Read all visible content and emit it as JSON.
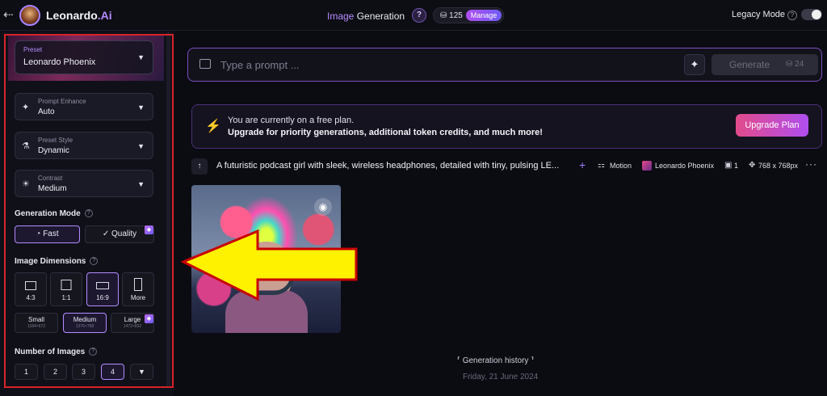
{
  "header": {
    "brand_name": "Leonardo",
    "brand_suffix": ".Ai",
    "mode_title_accent": "Image",
    "mode_title_rest": " Generation",
    "help_label": "?",
    "token_count": "125",
    "manage_label": "Manage",
    "legacy_mode_label": "Legacy Mode",
    "legacy_mode_on": false
  },
  "sidebar": {
    "preset": {
      "label": "Preset",
      "value": "Leonardo Phoenix"
    },
    "prompt_enhance": {
      "label": "Prompt Enhance",
      "value": "Auto"
    },
    "preset_style": {
      "label": "Preset Style",
      "value": "Dynamic"
    },
    "contrast": {
      "label": "Contrast",
      "value": "Medium"
    },
    "generation_mode": {
      "title": "Generation Mode",
      "fast_label": "Fast",
      "quality_label": "Quality",
      "selected": "Fast"
    },
    "image_dimensions": {
      "title": "Image Dimensions",
      "ratios": [
        "4:3",
        "1:1",
        "16:9",
        "More"
      ],
      "selected_ratio": "16:9",
      "sizes": [
        {
          "name": "Small",
          "px": "1184×672"
        },
        {
          "name": "Medium",
          "px": "1376×768"
        },
        {
          "name": "Large",
          "px": "1472×832"
        }
      ],
      "selected_size": "Medium"
    },
    "number_of_images": {
      "title": "Number of Images",
      "options": [
        "1",
        "2",
        "3",
        "4"
      ],
      "selected": "4"
    }
  },
  "prompt": {
    "placeholder": "Type a prompt ...",
    "value": "",
    "generate_label": "Generate",
    "generate_cost": "24"
  },
  "banner": {
    "line1": "You are currently on a free plan.",
    "line2": "Upgrade for priority generations, additional token credits, and much more!",
    "upgrade_label": "Upgrade Plan"
  },
  "generation": {
    "prompt_text": "A futuristic podcast girl with sleek, wireless headphones, detailed with tiny, pulsing LE...",
    "motion_label": "Motion",
    "model_label": "Leonardo Phoenix",
    "image_count": "1",
    "dimensions": "768 x 768px"
  },
  "history": {
    "title": "Generation history",
    "date": "Friday, 21 June 2024"
  },
  "colors": {
    "accent": "#b48cff",
    "highlight_outline": "#d8232a",
    "arrow_fill": "#fff200",
    "upgrade_gradient_start": "#e24b8a"
  }
}
